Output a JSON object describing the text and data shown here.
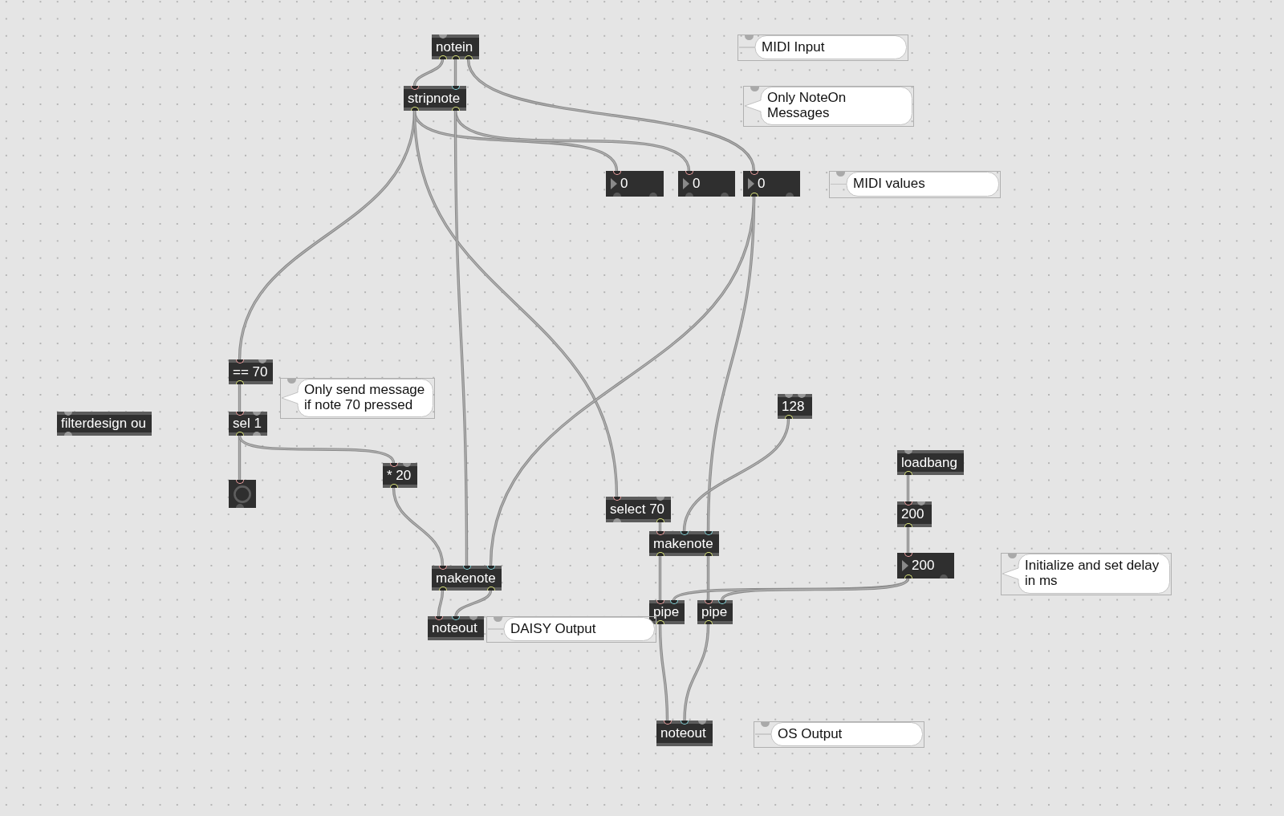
{
  "patcher": {
    "boxes": [
      {
        "kind": "object",
        "text": "notein"
      },
      {
        "kind": "comment",
        "lines": [
          "MIDI Input"
        ]
      },
      {
        "kind": "object",
        "text": "stripnote"
      },
      {
        "kind": "comment",
        "lines": [
          "Only NoteOn",
          "Messages"
        ]
      },
      {
        "kind": "number",
        "value": "0"
      },
      {
        "kind": "number",
        "value": "0"
      },
      {
        "kind": "number",
        "value": "0"
      },
      {
        "kind": "comment",
        "lines": [
          "MIDI values"
        ]
      },
      {
        "kind": "object",
        "text": "== 70"
      },
      {
        "kind": "comment",
        "lines": [
          "Only send message",
          "if note 70 pressed"
        ]
      },
      {
        "kind": "object",
        "text": "128"
      },
      {
        "kind": "object",
        "text": "filterdesign ou"
      },
      {
        "kind": "object",
        "text": "sel 1"
      },
      {
        "kind": "object",
        "text": "loadbang"
      },
      {
        "kind": "object",
        "text": "* 20"
      },
      {
        "kind": "bang"
      },
      {
        "kind": "object",
        "text": "select 70"
      },
      {
        "kind": "object",
        "text": "200"
      },
      {
        "kind": "object",
        "text": "makenote"
      },
      {
        "kind": "object",
        "text": "makenote"
      },
      {
        "kind": "number",
        "value": "200"
      },
      {
        "kind": "comment",
        "lines": [
          "Initialize and set delay",
          "in ms"
        ]
      },
      {
        "kind": "object",
        "text": "pipe"
      },
      {
        "kind": "object",
        "text": "pipe"
      },
      {
        "kind": "object",
        "text": "noteout"
      },
      {
        "kind": "comment",
        "lines": [
          "DAISY Output"
        ]
      },
      {
        "kind": "object",
        "text": "noteout"
      },
      {
        "kind": "comment",
        "lines": [
          "OS Output"
        ]
      }
    ]
  }
}
